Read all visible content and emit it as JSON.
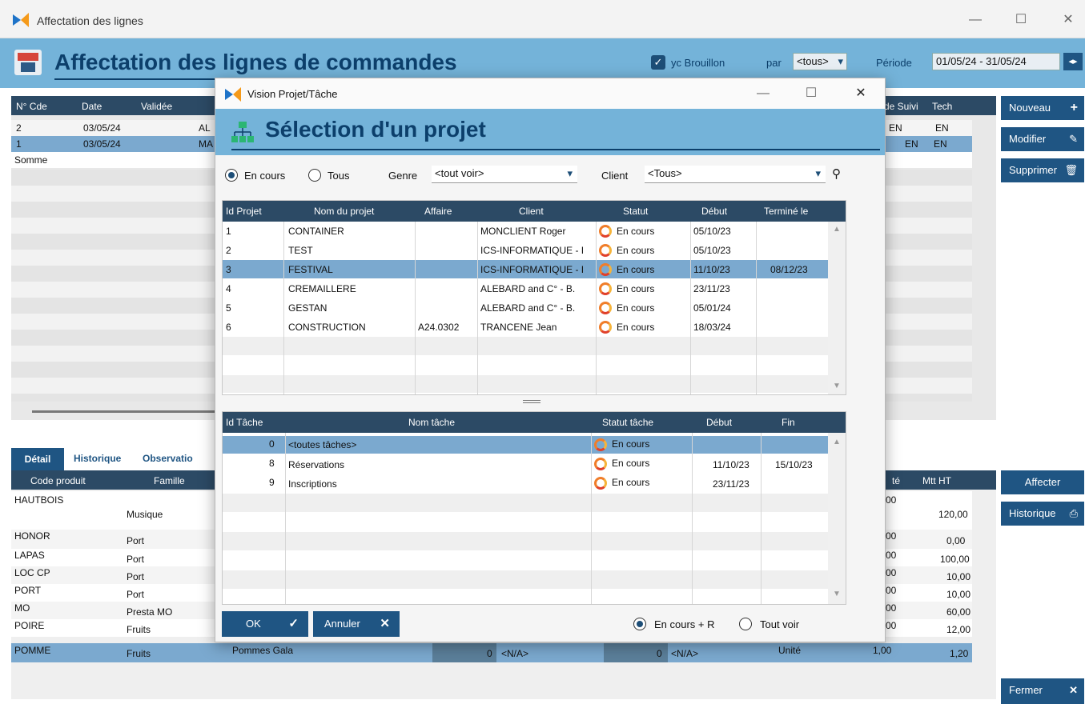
{
  "main": {
    "window_title": "Affectation des lignes",
    "heading": "Affectation des lignes de commandes",
    "yc_brouillon": "yc Brouillon",
    "par_label": "par",
    "par_value": "<tous>",
    "periode_label": "Période",
    "periode_value": "01/05/24 - 31/05/24",
    "orders_columns": [
      "N° Cde",
      "Date",
      "Validée",
      "de Suivi",
      "Tech"
    ],
    "orders_rows": [
      {
        "num": "2",
        "date": "03/05/24",
        "code": "AL",
        "suivi": "EN",
        "tech": "EN"
      },
      {
        "num": "1",
        "date": "03/05/24",
        "code": "MA",
        "suivi": "EN",
        "tech": "EN"
      }
    ],
    "somme": "Somme",
    "buttons": {
      "nouveau": "Nouveau",
      "modifier": "Modifier",
      "supprimer": "Supprimer",
      "affecter": "Affecter",
      "historique": "Historique",
      "fermer": "Fermer"
    },
    "tabs": [
      "Détail",
      "Historique",
      "Observatio"
    ],
    "detail_columns": {
      "code": "Code produit",
      "famille": "Famille",
      "qte": "té",
      "mtt": "Mtt HT"
    },
    "detail_rows": [
      {
        "code": "HAUTBOIS",
        "famille": "Musique",
        "qte": "00",
        "mtt": "120,00"
      },
      {
        "code": "HONOR",
        "famille": "Port",
        "qte": "00",
        "mtt": "0,00"
      },
      {
        "code": "LAPAS",
        "famille": "Port",
        "qte": "00",
        "mtt": "100,00"
      },
      {
        "code": "LOC CP",
        "famille": "Port",
        "qte": "00",
        "mtt": "10,00"
      },
      {
        "code": "PORT",
        "famille": "Port",
        "qte": "00",
        "mtt": "10,00"
      },
      {
        "code": "MO",
        "famille": "Presta MO",
        "qte": "00",
        "mtt": "60,00"
      },
      {
        "code": "POIRE",
        "famille": "Fruits",
        "qte": "00",
        "mtt": "12,00"
      }
    ],
    "selected_row": {
      "code": "POMME",
      "famille": "Fruits",
      "designation": "Pommes Gala",
      "v1": "0",
      "na1": "<N/A>",
      "v2": "0",
      "na2": "<N/A>",
      "unite": "Unité",
      "qte": "1,00",
      "mtt": "1,20"
    }
  },
  "modal": {
    "title": "Vision Projet/Tâche",
    "heading": "Sélection d'un projet",
    "radio_en_cours": "En cours",
    "radio_tous": "Tous",
    "genre_label": "Genre",
    "genre_value": "<tout voir>",
    "client_label": "Client",
    "client_value": "<Tous>",
    "projects_columns": {
      "id": "Id Projet",
      "nom": "Nom du projet",
      "affaire": "Affaire",
      "client": "Client",
      "statut": "Statut",
      "debut": "Début",
      "termine": "Terminé le"
    },
    "projects": [
      {
        "id": "1",
        "nom": "CONTAINER",
        "affaire": "",
        "client": "MONCLIENT Roger",
        "statut": "En cours",
        "debut": "05/10/23",
        "termine": ""
      },
      {
        "id": "2",
        "nom": "TEST",
        "affaire": "",
        "client": "ICS-INFORMATIQUE - I",
        "statut": "En cours",
        "debut": "05/10/23",
        "termine": ""
      },
      {
        "id": "3",
        "nom": "FESTIVAL",
        "affaire": "",
        "client": "ICS-INFORMATIQUE - I",
        "statut": "En cours",
        "debut": "11/10/23",
        "termine": "08/12/23"
      },
      {
        "id": "4",
        "nom": "CREMAILLERE",
        "affaire": "",
        "client": "ALEBARD and C° - B.",
        "statut": "En cours",
        "debut": "23/11/23",
        "termine": ""
      },
      {
        "id": "5",
        "nom": "GESTAN",
        "affaire": "",
        "client": "ALEBARD and C° - B.",
        "statut": "En cours",
        "debut": "05/01/24",
        "termine": ""
      },
      {
        "id": "6",
        "nom": "CONSTRUCTION",
        "affaire": "A24.0302",
        "client": "TRANCENE Jean",
        "statut": "En cours",
        "debut": "18/03/24",
        "termine": ""
      }
    ],
    "tasks_columns": {
      "id": "Id Tâche",
      "nom": "Nom tâche",
      "statut": "Statut tâche",
      "debut": "Début",
      "fin": "Fin"
    },
    "tasks": [
      {
        "id": "0",
        "nom": "<toutes tâches>",
        "statut": "En cours",
        "debut": "",
        "fin": ""
      },
      {
        "id": "8",
        "nom": "Réservations",
        "statut": "En cours",
        "debut": "11/10/23",
        "fin": "15/10/23"
      },
      {
        "id": "9",
        "nom": "Inscriptions",
        "statut": "En cours",
        "debut": "23/11/23",
        "fin": ""
      }
    ],
    "ok": "OK",
    "annuler": "Annuler",
    "radio_en_cours_r": "En cours + R",
    "radio_tout_voir": "Tout voir"
  }
}
